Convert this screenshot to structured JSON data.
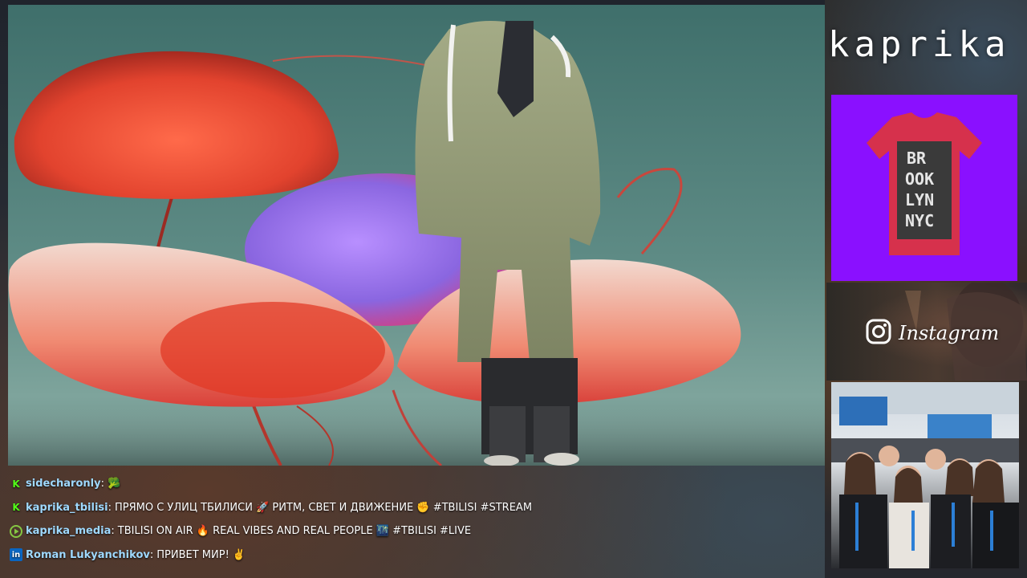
{
  "sidebar": {
    "brand": "kaprika",
    "merch_shirt_text": [
      "BR",
      "OOK",
      "LYN",
      "NYC"
    ],
    "instagram_label": "Instagram",
    "accent": "#8a10ff"
  },
  "chat": {
    "messages": [
      {
        "platform": "kick",
        "platform_icon": "kick-icon",
        "user": "sidecharonly",
        "user_color": "#9fd9ff",
        "text": "🥦"
      },
      {
        "platform": "kick",
        "platform_icon": "kick-icon",
        "user": "kaprika_tbilisi",
        "user_color": "#9fd9ff",
        "text": "ПРЯМО С УЛИЦ ТБИЛИСИ 🚀 РИТМ, СВЕТ И ДВИЖЕНИЕ ✊ #TBILISI #STREAM"
      },
      {
        "platform": "rumble",
        "platform_icon": "play-icon",
        "user": "kaprika_media",
        "user_color": "#9fd9ff",
        "text": "TBILISI ON AIR 🔥 REAL VIBES AND REAL PEOPLE 🌃 #TBILISI #LIVE"
      },
      {
        "platform": "linkedin",
        "platform_icon": "linkedin-icon",
        "user": "Roman Lukyanchikov",
        "user_color": "#9fd9ff",
        "text": "ПРИВЕТ МИР! ✌️"
      }
    ]
  }
}
